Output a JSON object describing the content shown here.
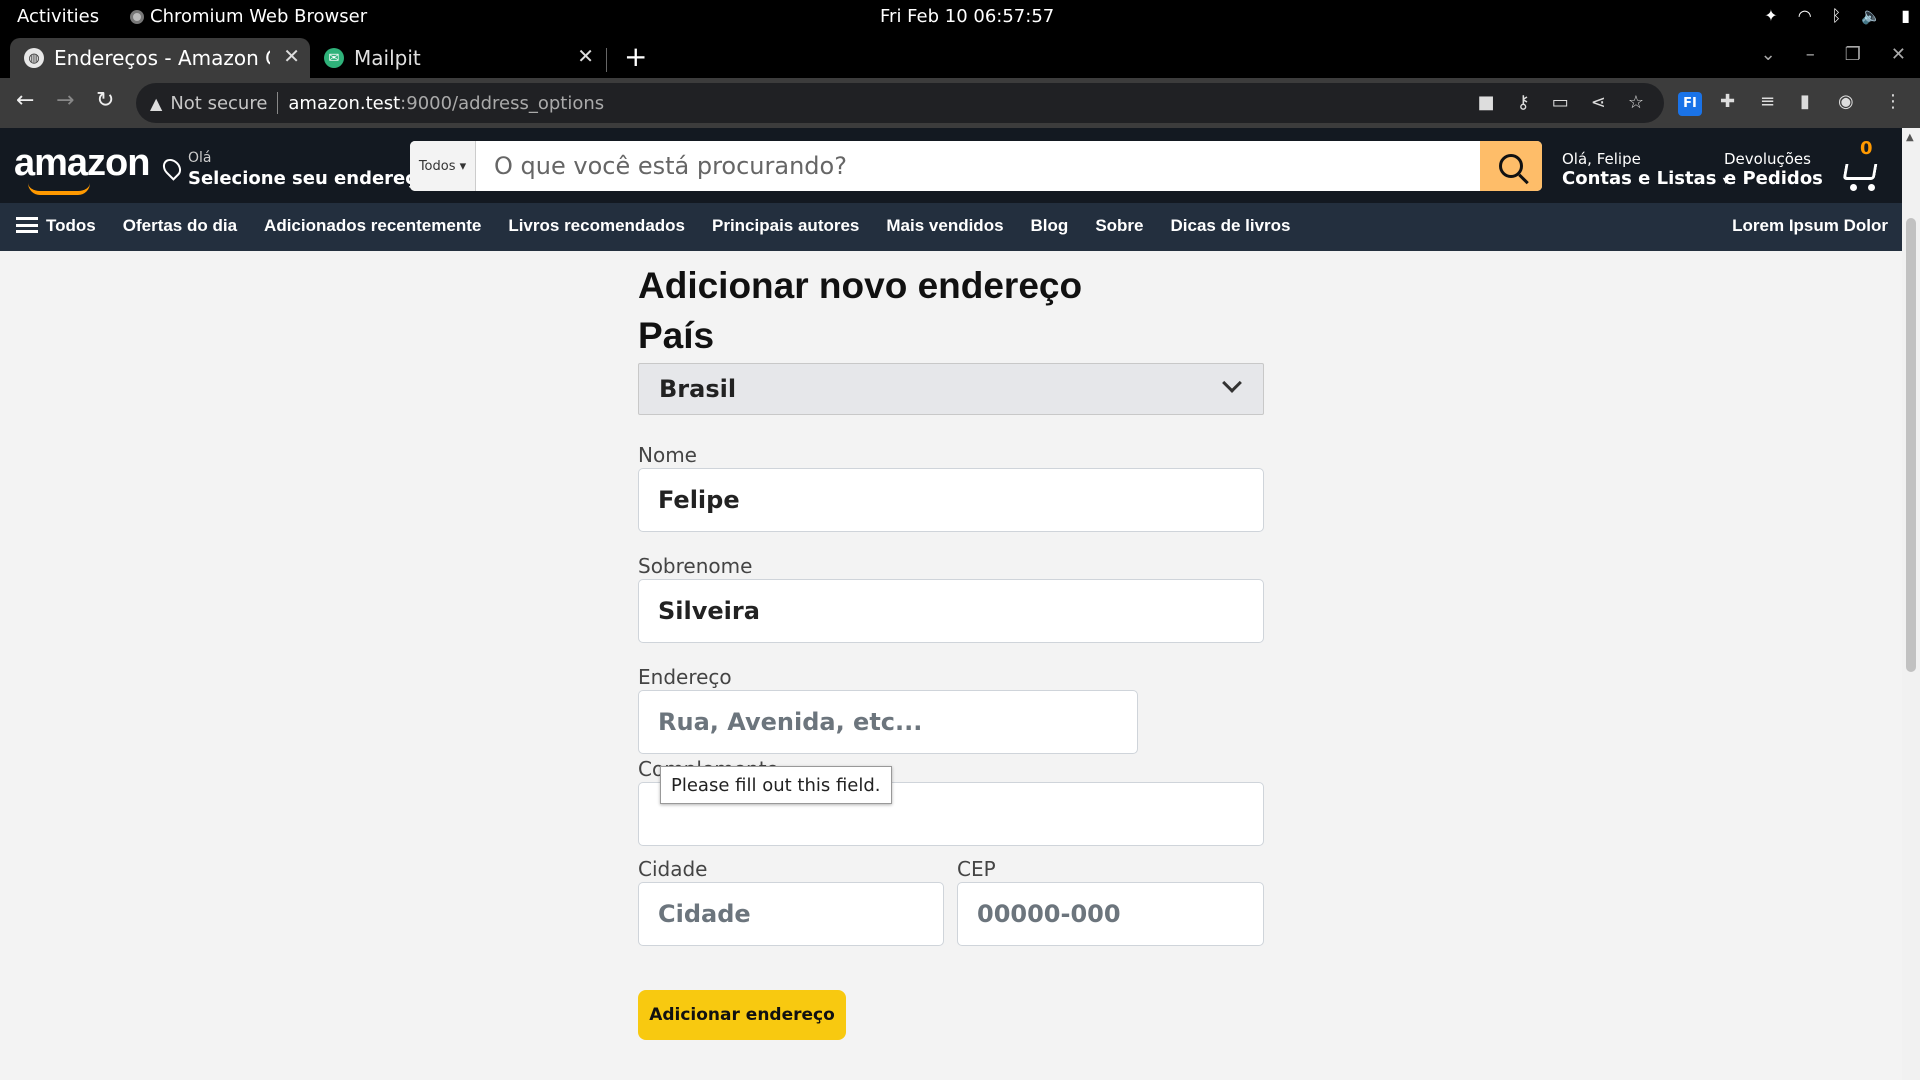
{
  "os_bar": {
    "activities": "Activities",
    "app_name": "Chromium Web Browser",
    "clock": "Fri Feb 10  06:57:57"
  },
  "browser": {
    "tabs": [
      {
        "title": "Endereços - Amazon Clo",
        "active": true
      },
      {
        "title": "Mailpit",
        "active": false
      }
    ],
    "security_label": "Not secure",
    "url_host": "amazon.test",
    "url_path": ":9000/address_options"
  },
  "amazon_header": {
    "logo": "amazon",
    "location_greeting": "Olá",
    "location_prompt": "Selecione seu endereço",
    "search_category": "Todos",
    "search_placeholder": "O que você está procurando?",
    "account_greeting": "Olá, Felipe",
    "account_menu": "Contas e Listas",
    "returns_line1": "Devoluções",
    "returns_line2": "e Pedidos",
    "cart_count": "0"
  },
  "nav": {
    "items": [
      "Todos",
      "Ofertas do dia",
      "Adicionados recentemente",
      "Livros recomendados",
      "Principais autores",
      "Mais vendidos",
      "Blog",
      "Sobre",
      "Dicas de livros"
    ],
    "right_item": "Lorem Ipsum Dolor"
  },
  "form": {
    "title": "Adicionar novo endereço",
    "country_label": "País",
    "country_value": "Brasil",
    "first_name_label": "Nome",
    "first_name_value": "Felipe",
    "last_name_label": "Sobrenome",
    "last_name_value": "Silveira",
    "address_label": "Endereço",
    "address_placeholder": "Rua, Avenida, etc...",
    "complement_label": "Complemento",
    "city_label": "Cidade",
    "city_placeholder": "Cidade",
    "zip_label": "CEP",
    "zip_placeholder": "00000-000",
    "submit_label": "Adicionar endereço"
  },
  "validation_tooltip": "Please fill out this field.",
  "colors": {
    "header_bg": "#131921",
    "nav_bg": "#232f3e",
    "search_button": "#febd69",
    "accent_orange": "#ff9900",
    "submit_button": "#f8c910"
  }
}
